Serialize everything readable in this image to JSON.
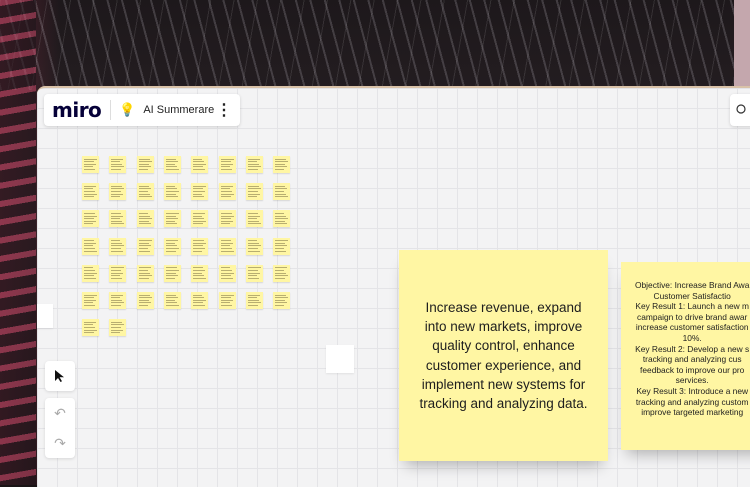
{
  "app": {
    "logo": "miro",
    "board_name": "AI Summerare",
    "board_icon": "lightbulb-emoji",
    "more_label": "⋮"
  },
  "toolbar": {
    "select_icon": "cursor-arrow-icon",
    "undo_icon": "undo-icon",
    "redo_icon": "redo-icon"
  },
  "stickies": {
    "main_text": "Increase revenue, expand into new markets, improve quality control, enhance customer experience, and implement new systems for tracking and analyzing data.",
    "okr_text": "Objective: Increase Brand Awa\n Customer Satisfactio\nKey Result 1: Launch a new m\ncampaign to drive brand awar\nincrease customer satisfaction\n10%.\nKey Result 2: Develop a new s\ntracking and analyzing cus\nfeedback to improve our pro\nservices.\nKey Result 3: Introduce a new\ntracking and analyzing custom\nimprove targeted marketing"
  },
  "mini_grid": {
    "rows": [
      8,
      8,
      8,
      8,
      8,
      8,
      2
    ],
    "color": "#fff6a3"
  },
  "colors": {
    "sticky_yellow": "#fff6a3",
    "logo_navy": "#050038"
  }
}
